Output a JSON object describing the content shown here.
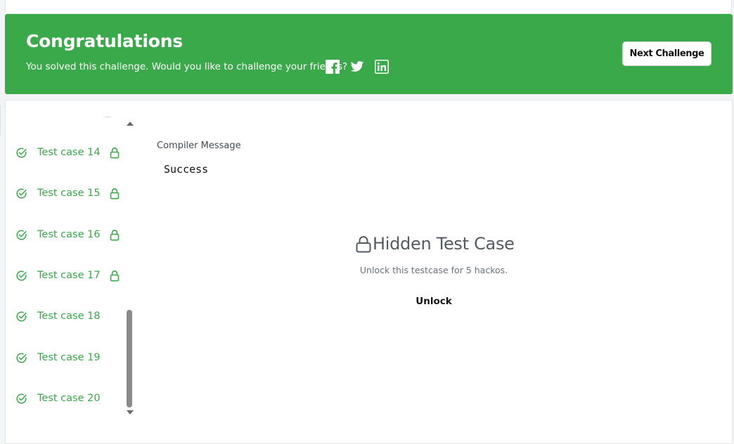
{
  "banner": {
    "title": "Congratulations",
    "message": "You solved this challenge. Would you like to challenge your friends?",
    "next_button": "Next Challenge",
    "share_icons": [
      "facebook-icon",
      "twitter-icon",
      "linkedin-icon"
    ],
    "background_color": "#39a949"
  },
  "test_cases": [
    {
      "label": "Test case 14",
      "locked": true,
      "status": "passed"
    },
    {
      "label": "Test case 15",
      "locked": true,
      "status": "passed"
    },
    {
      "label": "Test case 16",
      "locked": true,
      "status": "passed"
    },
    {
      "label": "Test case 17",
      "locked": true,
      "status": "passed"
    },
    {
      "label": "Test case 18",
      "locked": false,
      "status": "passed"
    },
    {
      "label": "Test case 19",
      "locked": false,
      "status": "passed"
    },
    {
      "label": "Test case 20",
      "locked": false,
      "status": "passed"
    }
  ],
  "compiler": {
    "label": "Compiler Message",
    "value": "Success"
  },
  "hidden": {
    "title": "Hidden Test Case",
    "unlock_text": "Unlock this testcase for 5 hackos.",
    "unlock_button": "Unlock"
  },
  "colors": {
    "accent_green": "#39a949",
    "text_dark": "#111111",
    "text_muted": "#6b7079"
  }
}
